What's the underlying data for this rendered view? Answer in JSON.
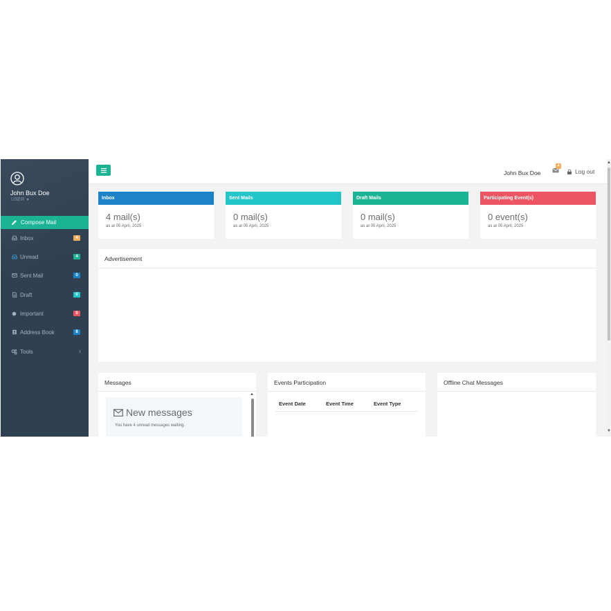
{
  "sidebar": {
    "user_name": "John Bux Doe",
    "user_role": "USER",
    "compose_label": "Compose Mail",
    "items": [
      {
        "label": "Inbox",
        "icon": "inbox-icon",
        "badge": "4",
        "badge_color": "#f8ac59"
      },
      {
        "label": "Unread",
        "icon": "inbox-open-icon",
        "badge": "4",
        "badge_color": "#1ab394"
      },
      {
        "label": "Sent Mail",
        "icon": "envelope-icon",
        "badge": "0",
        "badge_color": "#1c84c6"
      },
      {
        "label": "Draft",
        "icon": "file-icon",
        "badge": "0",
        "badge_color": "#23c6c8"
      },
      {
        "label": "Important",
        "icon": "circle-icon",
        "badge": "0",
        "badge_color": "#ed5565"
      },
      {
        "label": "Address Book",
        "icon": "address-book-icon",
        "badge": "8",
        "badge_color": "#1c84c6"
      },
      {
        "label": "Tools",
        "icon": "gears-icon",
        "chevron": "‹"
      }
    ]
  },
  "topbar": {
    "user_name": "John Bux Doe",
    "mail_count": "4",
    "logout_label": "Log out"
  },
  "stats": [
    {
      "title": "Inbox",
      "value": "4 mail(s)",
      "date": "as at 05 April, 2025",
      "color": "#1c84c6"
    },
    {
      "title": "Sent Mails",
      "value": "0 mail(s)",
      "date": "as at 05 April, 2025",
      "color": "#23c6c8"
    },
    {
      "title": "Draft Mails",
      "value": "0 mail(s)",
      "date": "as at 05 April, 2025",
      "color": "#1ab394"
    },
    {
      "title": "Participating Event(s)",
      "value": "0 event(s)",
      "date": "as at 05 April, 2025",
      "color": "#ed5565"
    }
  ],
  "advertisement": {
    "title": "Advertisement"
  },
  "messages": {
    "title": "Messages",
    "box_title": "New messages",
    "box_sub": "You have 4 unread messages waiting."
  },
  "events": {
    "title": "Events Participation",
    "columns": [
      "Event Date",
      "Event Time",
      "Event Type"
    ]
  },
  "chat": {
    "title": "Offline Chat Messages"
  }
}
